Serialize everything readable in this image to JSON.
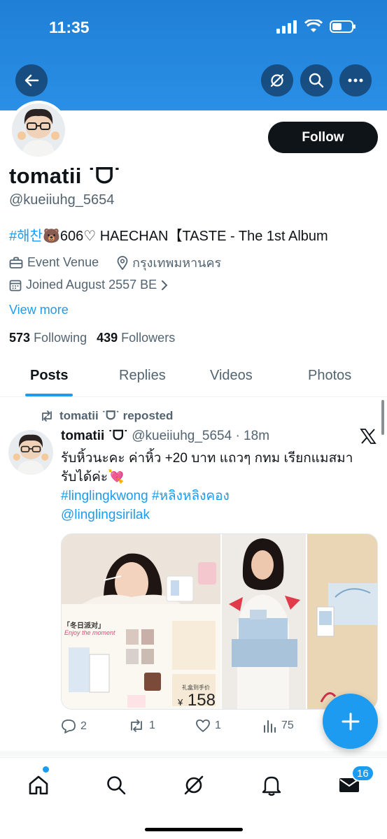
{
  "status_bar": {
    "time": "11:35"
  },
  "header": {
    "back_icon": "arrow-left-icon",
    "grok_icon": "grok-icon",
    "search_icon": "search-icon",
    "more_icon": "more-horizontal-icon"
  },
  "profile": {
    "follow_label": "Follow",
    "display_name": "tomatii ˙ᗜ˙",
    "handle": "@kueiiuhg_5654",
    "bio_tag": "#해찬",
    "bio_rest": "🐻606♡ HAECHAN【TASTE - The 1st Album",
    "category": "Event Venue",
    "location": "กรุงเทพมหานคร",
    "joined": "Joined August 2557 BE",
    "view_more": "View more",
    "following_count": "573",
    "following_label": "Following",
    "followers_count": "439",
    "followers_label": "Followers"
  },
  "tabs": [
    {
      "label": "Posts"
    },
    {
      "label": "Replies"
    },
    {
      "label": "Videos"
    },
    {
      "label": "Photos"
    }
  ],
  "post": {
    "repost_label": "tomatii ˙ᗜ˙ reposted",
    "author_name": "tomatii ˙ᗜ˙",
    "author_handle": "@kueiiuhg_5654",
    "time": "· 18m",
    "text_line1": "รับหิ้วนะคะ ค่าหิ้ว +20 บาท แถวๆ กทม เรียกแมสมา",
    "text_line2": "รับได้ค่ะ💘",
    "hashtag1": "#linglingkwong",
    "hashtag2": "#หลิงหลิงคอง",
    "mention": "@linglingsirilak",
    "media_text_a": "「冬日派对」",
    "media_text_b": "Enjoy the moment",
    "media_text_c": "礼盒到手价",
    "media_price_symbol": "¥",
    "media_price": "158",
    "reply_count": "2",
    "repost_count": "1",
    "like_count": "1",
    "view_count": "75"
  },
  "bottom_nav": {
    "items": [
      "home-icon",
      "search-icon",
      "grok-icon",
      "notifications-icon",
      "messages-icon"
    ],
    "messages_badge": "16"
  },
  "colors": {
    "header_blue": "#2a8fe6",
    "accent": "#1d9bf0",
    "text_primary": "#0f1419",
    "text_secondary": "#536471"
  }
}
